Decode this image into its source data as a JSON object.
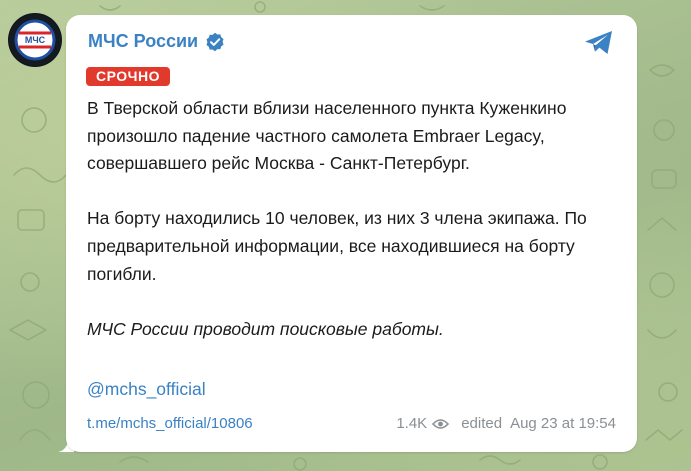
{
  "channel": {
    "name": "МЧС России",
    "avatar_text": "МЧС"
  },
  "post": {
    "badge": "СРОЧНО",
    "paragraph1": "В Тверской области вблизи населенного пункта Куженкино произошло падение частного самолета Embraer Legacy, совершавшего рейс Москва - Санкт-Петербург.",
    "paragraph2": "На борту находились 10 человек, из них 3 члена экипажа. По предварительной информации, все находившиеся на борту погибли.",
    "paragraph3": "МЧС России проводит поисковые работы.",
    "mention": "@mchs_official",
    "link": "t.me/mchs_official/10806",
    "views": "1.4K",
    "edited": "edited",
    "timestamp": "Aug 23 at 19:54"
  },
  "icons": {
    "verified": "verified-badge-icon",
    "share": "telegram-share-icon",
    "views": "eye-icon"
  },
  "colors": {
    "accent": "#3a82c4",
    "badge": "#e2392d",
    "bubble": "#ffffff",
    "wallpaper": "#a9bf8e"
  }
}
